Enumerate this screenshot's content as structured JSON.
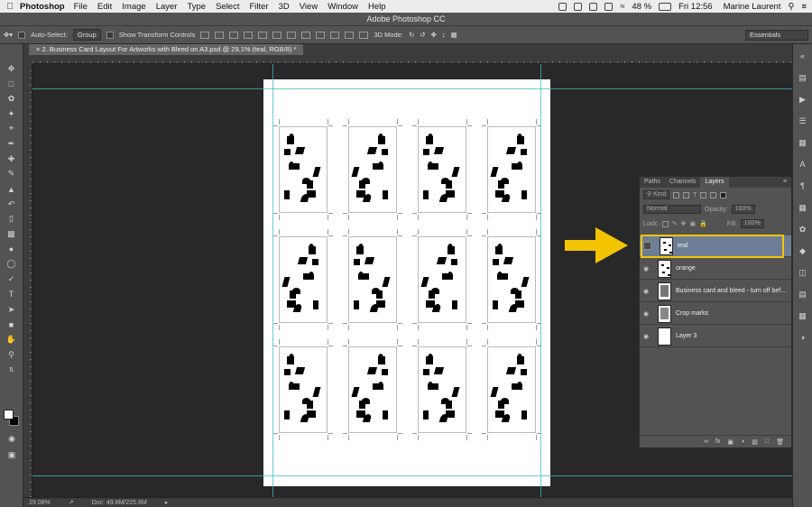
{
  "menubar": {
    "app": "Photoshop",
    "items": [
      "File",
      "Edit",
      "Image",
      "Layer",
      "Type",
      "Select",
      "Filter",
      "3D",
      "View",
      "Window",
      "Help"
    ],
    "battery": "48 %",
    "clock": "Fri 12:56",
    "user": "Marine Laurent"
  },
  "window_title": "Adobe Photoshop CC",
  "options": {
    "auto_select_label": "Auto-Select:",
    "auto_select_value": "Group",
    "transform_label": "Show Transform Controls",
    "mode_3d_label": "3D Mode:",
    "workspace": "Essentials"
  },
  "document": {
    "tab_title": "2. Business Card Layout For Artworks with Bleed on A3.psd @ 29.1% (teal, RGB/8) *"
  },
  "status": {
    "zoom": "29.08%",
    "doc_size": "Doc: 49.8M/225.6M"
  },
  "layers_panel": {
    "tabs": [
      "Paths",
      "Channels",
      "Layers"
    ],
    "active_tab": "Layers",
    "filter_kind": "Kind",
    "blend_mode": "Normal",
    "opacity_label": "Opacity:",
    "opacity_value": "100%",
    "lock_label": "Lock:",
    "fill_label": "Fill:",
    "fill_value": "100%",
    "layers": [
      {
        "name": "teal",
        "visible": false,
        "selected": true
      },
      {
        "name": "orange",
        "visible": true,
        "selected": false
      },
      {
        "name": "Business card and bleed - turn off bef...",
        "visible": true,
        "selected": false
      },
      {
        "name": "Crop marks",
        "visible": true,
        "selected": false
      },
      {
        "name": "Layer 3",
        "visible": true,
        "selected": false
      }
    ]
  },
  "annotation": {
    "color": "#f5c400"
  },
  "colors": {
    "guide": "#3fb8c6",
    "panel": "#535353",
    "selection": "#6d7d95"
  }
}
